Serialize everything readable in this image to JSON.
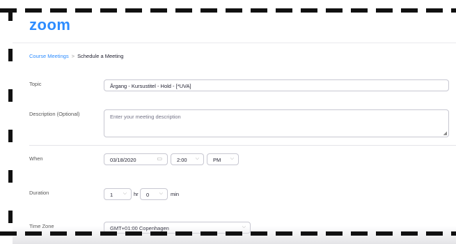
{
  "app": {
    "logo_text": "zoom"
  },
  "breadcrumb": {
    "parent": "Course Meetings",
    "separator": ">",
    "current": "Schedule a Meeting"
  },
  "form": {
    "topic": {
      "label": "Topic",
      "value": "Årgang - Kursustitel - Hold - [*UVA]"
    },
    "description": {
      "label": "Description (Optional)",
      "placeholder": "Enter your meeting description"
    },
    "when": {
      "label": "When",
      "date": "03/18/2020",
      "time": "2:00",
      "ampm": "PM"
    },
    "duration": {
      "label": "Duration",
      "hours": "1",
      "hours_unit": "hr",
      "minutes": "0",
      "minutes_unit": "min"
    },
    "time_zone": {
      "label": "Time Zone",
      "value": "GMT+01:00 Copenhagen"
    }
  },
  "colors": {
    "brand": "#2d8cff",
    "text": "#232333",
    "border": "#c7c7d1"
  },
  "icons": {
    "calendar": "calendar-icon",
    "chevron": "chevron-down-icon",
    "resize": "resize-handle-icon"
  }
}
